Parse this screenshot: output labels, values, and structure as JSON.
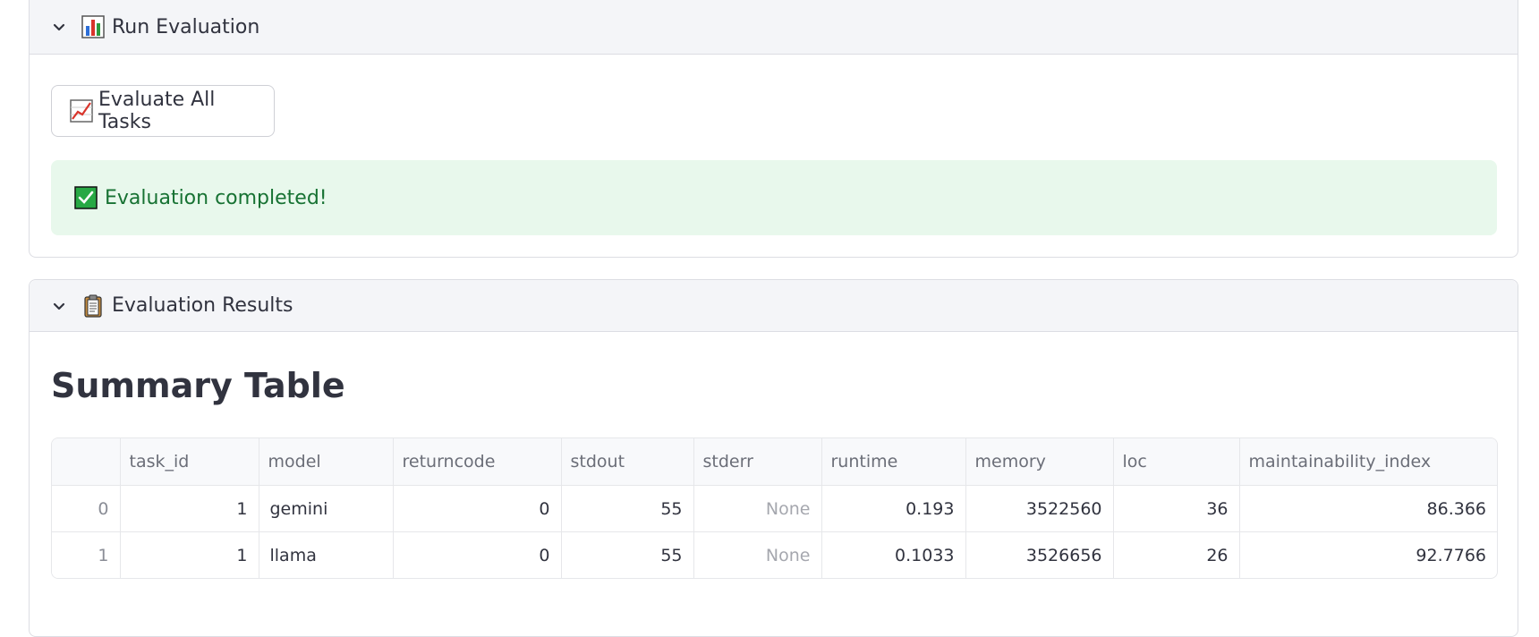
{
  "run_section": {
    "title": "Run Evaluation",
    "icon": "bar-chart-icon",
    "button_label": "Evaluate All Tasks",
    "button_icon": "chart-increasing-icon",
    "success_message": "Evaluation completed!",
    "success_icon": "check-mark-button-icon",
    "success_color": "#177233",
    "success_bg": "#e8f8ec"
  },
  "results_section": {
    "title": "Evaluation Results",
    "icon": "clipboard-icon",
    "heading": "Summary Table",
    "table": {
      "columns": [
        "",
        "task_id",
        "model",
        "returncode",
        "stdout",
        "stderr",
        "runtime",
        "memory",
        "loc",
        "maintainability_index"
      ],
      "rows": [
        [
          "0",
          "1",
          "gemini",
          "0",
          "55",
          "None",
          "0.193",
          "3522560",
          "36",
          "86.366"
        ],
        [
          "1",
          "1",
          "llama",
          "0",
          "55",
          "None",
          "0.1033",
          "3526656",
          "26",
          "92.7766"
        ]
      ]
    }
  }
}
